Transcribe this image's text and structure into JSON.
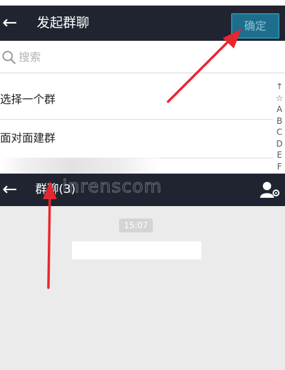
{
  "create_group": {
    "title": "发起群聊",
    "back_icon": "←",
    "confirm_label": "确定",
    "search": {
      "placeholder": "搜索"
    },
    "options": [
      {
        "label": "选择一个群"
      },
      {
        "label": "面对面建群"
      }
    ],
    "index": [
      "↑",
      "☆",
      "A",
      "B",
      "C",
      "D",
      "E",
      "F"
    ]
  },
  "group_chat": {
    "title": "群聊(3)",
    "back_icon": "←",
    "timestamp": "15:07"
  },
  "watermark": "inrenscom",
  "colors": {
    "nav_bg": "#1f2430",
    "confirm_bg": "#1d6e8c",
    "chat_bg": "#ebebeb",
    "arrow_red": "#e8262d"
  },
  "icons": {
    "back": "arrow-left-icon",
    "search": "magnifier-icon",
    "group_info": "person-gear-icon"
  }
}
